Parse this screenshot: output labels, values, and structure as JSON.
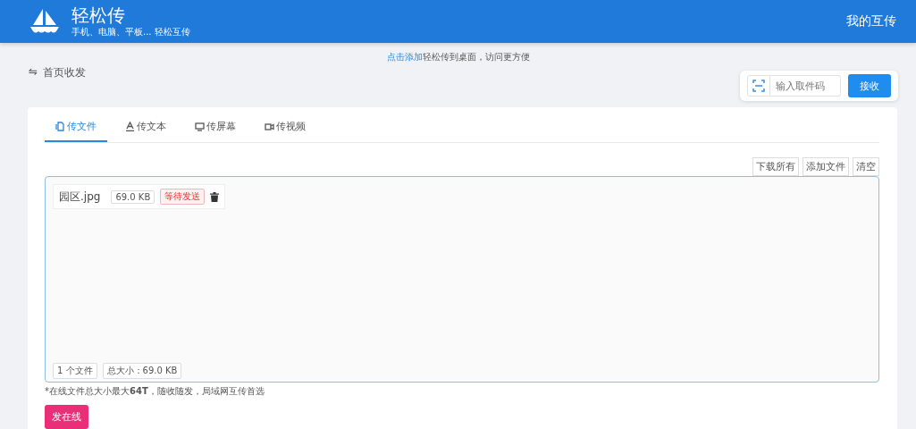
{
  "header": {
    "title": "轻松传",
    "subtitle": "手机、电脑、平板... 轻松互传",
    "link": "我的互传"
  },
  "notice": {
    "link": "点击添加",
    "text": "轻松传到桌面，访问更方便"
  },
  "breadcrumb": {
    "icon": "⇋",
    "label": "首页收发"
  },
  "receive": {
    "placeholder": "输入取件码",
    "button": "接收"
  },
  "tabs": [
    {
      "kind": "file",
      "label": "传文件",
      "selected": true
    },
    {
      "kind": "text",
      "label": "传文本",
      "selected": false
    },
    {
      "kind": "screen",
      "label": "传屏幕",
      "selected": false
    },
    {
      "kind": "video",
      "label": "传视频",
      "selected": false
    }
  ],
  "toolbar": [
    "下载所有",
    "添加文件",
    "清空"
  ],
  "files": [
    {
      "name": "园区.jpg",
      "size": "69.0 KB",
      "status": "等待发送"
    }
  ],
  "summary": [
    "1 个文件",
    "总大小：69.0 KB"
  ],
  "note": "*在线文件总大小最大**64T**，随收随发，局域网互传首选",
  "send_button": "发在线"
}
